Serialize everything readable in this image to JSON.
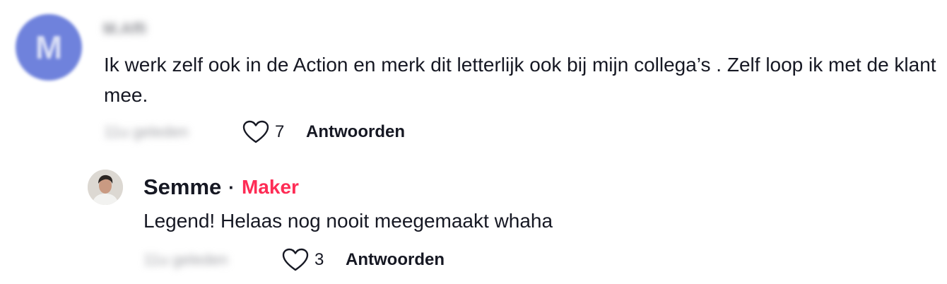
{
  "comment": {
    "avatar_letter": "M",
    "username": "M.Affi",
    "text": "Ik werk zelf ook in de Action en merk dit letterlijk ook bij mijn collega’s . Zelf loop ik met de klant mee.",
    "time": "11u geleden",
    "likes": "7",
    "reply_label": "Antwoorden",
    "avatar_color": "#6f82dc"
  },
  "reply": {
    "username": "Semme",
    "separator": "·",
    "badge": "Maker",
    "badge_color": "#fe2c55",
    "text": "Legend! Helaas nog nooit meegemaakt whaha",
    "time": "11u geleden",
    "likes": "3",
    "reply_label": "Antwoorden"
  },
  "icons": {
    "like": "heart-outline-icon"
  }
}
